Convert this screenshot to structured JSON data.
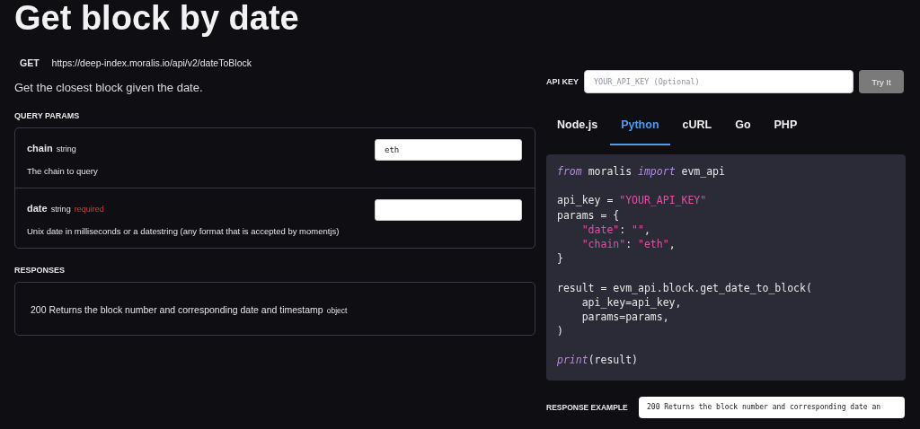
{
  "title": "Get block by date",
  "endpoint": {
    "method": "GET",
    "url": "https://deep-index.moralis.io/api/v2/dateToBlock"
  },
  "description": "Get the closest block given the date.",
  "query_params": {
    "heading": "QUERY PARAMS",
    "params": [
      {
        "name": "chain",
        "type": "string",
        "description": "The chain to query",
        "value": "eth"
      },
      {
        "name": "date",
        "type": "string",
        "required": "required",
        "description": "Unix date in milliseconds or a datestring (any format that is accepted by momentjs)"
      }
    ]
  },
  "responses": {
    "heading": "RESPONSES",
    "items": [
      {
        "code": "200",
        "text": "Returns the block number and corresponding date and timestamp",
        "type": "object"
      }
    ]
  },
  "api_key": {
    "label": "API KEY",
    "placeholder": "YOUR_API_KEY (Optional)",
    "button": "Try It",
    "disabled": true
  },
  "tabs": [
    {
      "label": "Node.js",
      "selected": false
    },
    {
      "label": "Python",
      "selected": true
    },
    {
      "label": "cURL",
      "selected": false
    },
    {
      "label": "Go",
      "selected": false
    },
    {
      "label": "PHP",
      "selected": false
    }
  ],
  "code_lines": [
    {
      "kind": "code",
      "indented": false,
      "tokens": [
        {
          "kind": "keyword",
          "text": "from"
        },
        {
          "kind": "plain",
          "text": " moralis "
        },
        {
          "kind": "keyword",
          "text": "import"
        },
        {
          "kind": "plain",
          "text": " evm_api"
        }
      ]
    },
    {
      "kind": "blank"
    },
    {
      "kind": "code",
      "indented": false,
      "tokens": [
        {
          "kind": "plain",
          "text": "api_key = "
        },
        {
          "kind": "string",
          "text": "\"YOUR_API_KEY\""
        }
      ]
    },
    {
      "kind": "code",
      "indented": false,
      "tokens": [
        {
          "kind": "plain",
          "text": "params = {"
        }
      ]
    },
    {
      "kind": "code",
      "indented": true,
      "tokens": [
        {
          "kind": "string",
          "text": "\"date\""
        },
        {
          "kind": "plain",
          "text": ": "
        },
        {
          "kind": "string",
          "text": "\"\""
        },
        {
          "kind": "plain",
          "text": ","
        }
      ]
    },
    {
      "kind": "code",
      "indented": true,
      "tokens": [
        {
          "kind": "string",
          "text": "\"chain\""
        },
        {
          "kind": "plain",
          "text": ": "
        },
        {
          "kind": "string",
          "text": "\"eth\""
        },
        {
          "kind": "plain",
          "text": ","
        }
      ]
    },
    {
      "kind": "code",
      "indented": false,
      "tokens": [
        {
          "kind": "plain",
          "text": "}"
        }
      ]
    },
    {
      "kind": "blank"
    },
    {
      "kind": "code",
      "indented": false,
      "tokens": [
        {
          "kind": "plain",
          "text": "result = evm_api.block.get_date_to_block("
        }
      ]
    },
    {
      "kind": "code",
      "indented": true,
      "tokens": [
        {
          "kind": "plain",
          "text": "api_key=api_key,"
        }
      ]
    },
    {
      "kind": "code",
      "indented": true,
      "tokens": [
        {
          "kind": "plain",
          "text": "params=params,"
        }
      ]
    },
    {
      "kind": "code",
      "indented": false,
      "tokens": [
        {
          "kind": "plain",
          "text": ")"
        }
      ]
    },
    {
      "kind": "blank"
    },
    {
      "kind": "code",
      "indented": false,
      "tokens": [
        {
          "kind": "keyword",
          "text": "print"
        },
        {
          "kind": "plain",
          "text": "(result)"
        }
      ]
    }
  ],
  "response_example": {
    "label": "RESPONSE EXAMPLE",
    "value": "200 Returns the block number and corresponding date an"
  }
}
